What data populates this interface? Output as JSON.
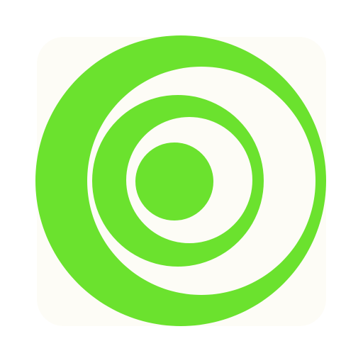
{
  "icon": {
    "name": "concentric-rings-logo-icon",
    "colors": {
      "page_background": "#ffffff",
      "tile_background": "#fdfcf6",
      "ring_green": "#6be22e"
    }
  }
}
